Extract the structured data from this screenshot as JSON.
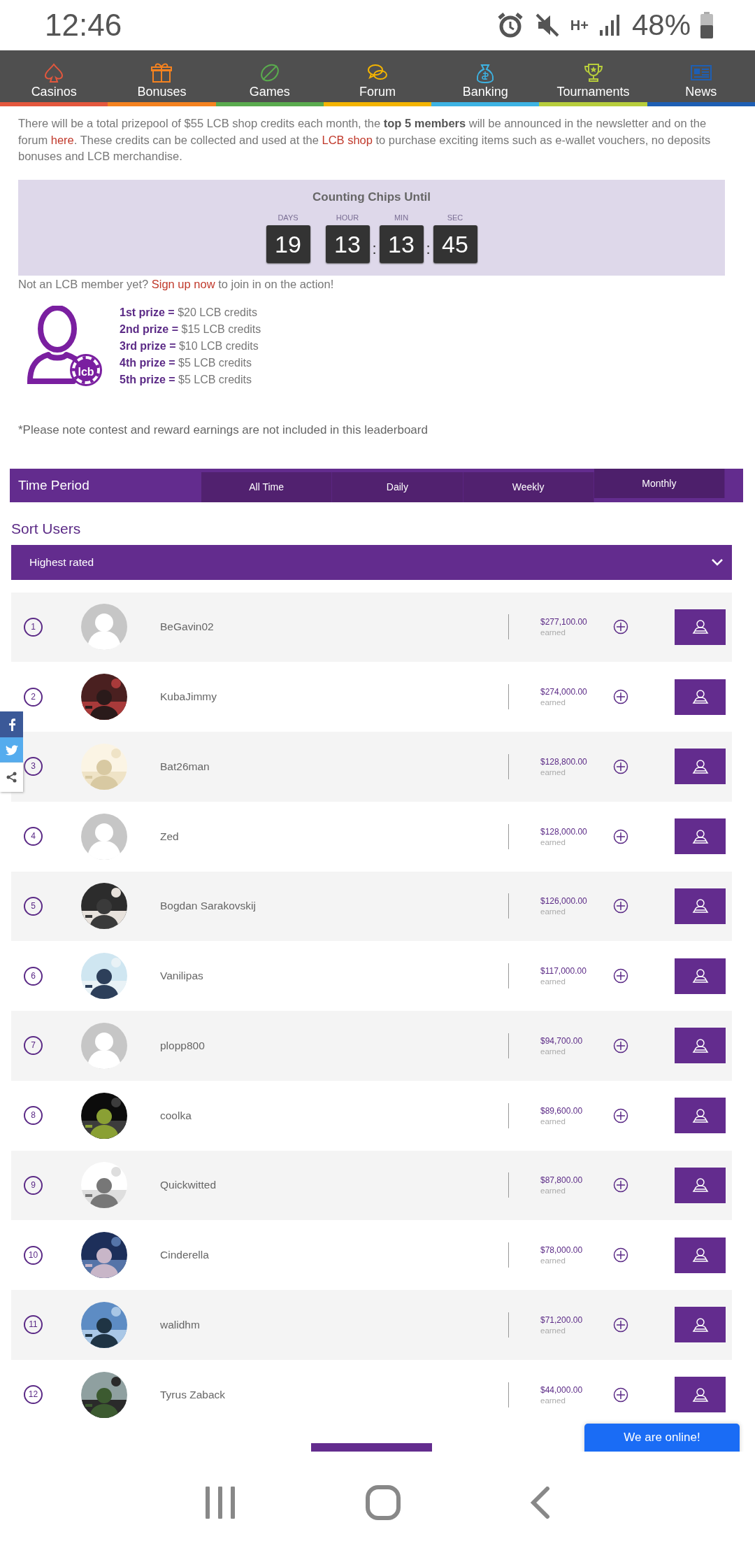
{
  "status_bar": {
    "time": "12:46",
    "network": "H+",
    "battery": "48%"
  },
  "nav": {
    "items": [
      {
        "label": "Casinos",
        "color": "#e4573d"
      },
      {
        "label": "Bonuses",
        "color": "#f5821f"
      },
      {
        "label": "Games",
        "color": "#5aab4e"
      },
      {
        "label": "Forum",
        "color": "#f4b400"
      },
      {
        "label": "Banking",
        "color": "#3db3e3"
      },
      {
        "label": "Tournaments",
        "color": "#b7cd3b"
      },
      {
        "label": "News",
        "color": "#1e5fb4"
      }
    ]
  },
  "intro": {
    "paragraph": [
      {
        "kind": "text",
        "text": "There will be a total prizepool of $55 LCB shop credits each month, the "
      },
      {
        "kind": "bold",
        "text": "top 5 members"
      },
      {
        "kind": "text",
        "text": " will be announced in the newsletter and on the forum "
      },
      {
        "kind": "link",
        "text": "here"
      },
      {
        "kind": "text",
        "text": ". These credits can be collected and used at the "
      },
      {
        "kind": "link",
        "text": "LCB shop"
      },
      {
        "kind": "text",
        "text": " to purchase exciting items such as e-wallet vouchers, no deposits bonuses and LCB merchandise."
      }
    ]
  },
  "countdown": {
    "title": "Counting Chips Until",
    "units": [
      {
        "label": "DAYS",
        "value": "19"
      },
      {
        "label": "HOUR",
        "value": "13"
      },
      {
        "label": "MIN",
        "value": "13",
        "separator": ":"
      },
      {
        "label": "SEC",
        "value": "45",
        "separator": ":"
      }
    ]
  },
  "signup": [
    {
      "kind": "text",
      "text": "Not an LCB member yet? "
    },
    {
      "kind": "link",
      "text": "Sign up now"
    },
    {
      "kind": "text",
      "text": " to join in on the action!"
    }
  ],
  "prizes": {
    "chip_label": "lcb",
    "items": [
      "**1st prize =** $20 LCB credits",
      "**2nd prize =** $15 LCB credits",
      "**3rd prize =** $10 LCB credits",
      "**4th prize =** $5 LCB credits",
      "**5th prize =** $5 LCB credits"
    ]
  },
  "note": "*Please note contest and reward earnings are not included in this leaderboard",
  "time_period": {
    "label": "Time Period",
    "tabs": [
      {
        "label": "All Time",
        "selected": false
      },
      {
        "label": "Daily",
        "selected": false
      },
      {
        "label": "Weekly",
        "selected": false
      },
      {
        "label": "Monthly",
        "selected": true
      }
    ]
  },
  "sort_users": {
    "title": "Sort Users",
    "value": "Highest rated"
  },
  "leaderboard": [
    {
      "rank": "1",
      "kind": "default_avatar",
      "name": "BeGavin02",
      "amount": "$277,100.00",
      "caption": "earned"
    },
    {
      "rank": "2",
      "name": "KubaJimmy",
      "amount": "$274,000.00",
      "caption": "earned"
    },
    {
      "rank": "3",
      "name": "Bat26man",
      "amount": "$128,800.00",
      "caption": "earned"
    },
    {
      "rank": "4",
      "kind": "default_avatar",
      "name": "Zed",
      "amount": "$128,000.00",
      "caption": "earned"
    },
    {
      "rank": "5",
      "name": "Bogdan Sarakovskij",
      "amount": "$126,000.00",
      "caption": "earned"
    },
    {
      "rank": "6",
      "name": "Vanilipas",
      "amount": "$117,000.00",
      "caption": "earned"
    },
    {
      "rank": "7",
      "kind": "default_avatar",
      "name": "plopp800",
      "amount": "$94,700.00",
      "caption": "earned"
    },
    {
      "rank": "8",
      "name": "coolka",
      "amount": "$89,600.00",
      "caption": "earned"
    },
    {
      "rank": "9",
      "name": "Quickwitted",
      "amount": "$87,800.00",
      "caption": "earned"
    },
    {
      "rank": "10",
      "name": "Cinderella",
      "amount": "$78,000.00",
      "caption": "earned"
    },
    {
      "rank": "11",
      "name": "walidhm",
      "amount": "$71,200.00",
      "caption": "earned"
    },
    {
      "rank": "12",
      "name": "Tyrus Zaback",
      "amount": "$44,000.00",
      "caption": "earned"
    }
  ],
  "chat": {
    "label": "We are online!"
  }
}
